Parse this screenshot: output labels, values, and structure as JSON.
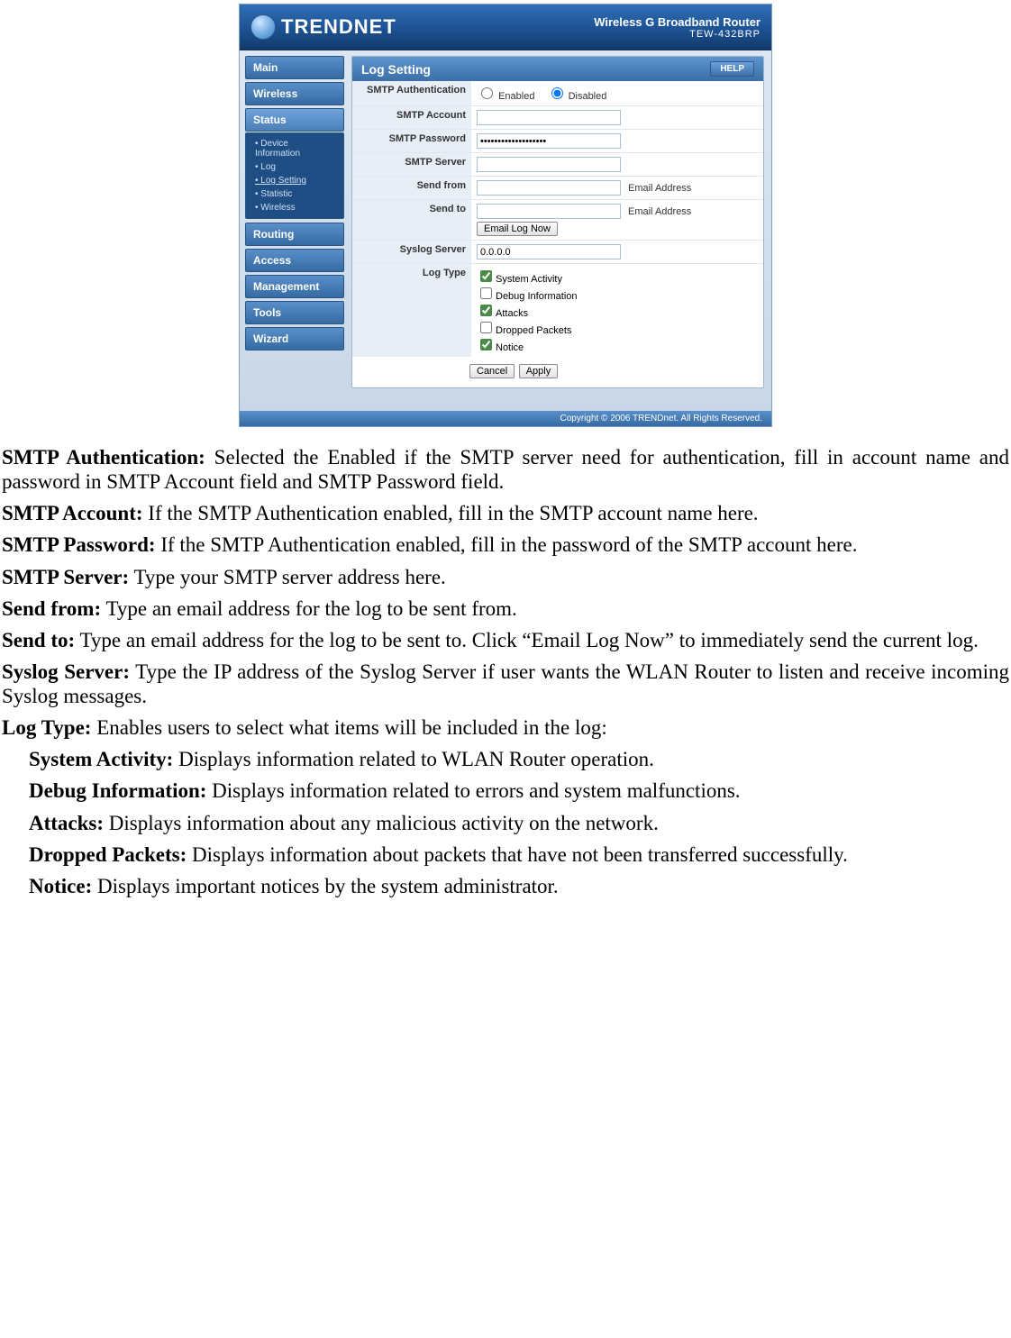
{
  "brand": "TRENDNET",
  "device_name": "Wireless G Broadband Router",
  "device_model": "TEW-432BRP",
  "nav": {
    "main": "Main",
    "wireless": "Wireless",
    "status": "Status",
    "routing": "Routing",
    "access": "Access",
    "management": "Management",
    "tools": "Tools",
    "wizard": "Wizard"
  },
  "subnav": {
    "device_info": "Device Information",
    "log": "Log",
    "log_setting": "Log Setting",
    "statistic": "Statistic",
    "wireless": "Wireless"
  },
  "panel": {
    "title": "Log Setting",
    "help": "HELP",
    "labels": {
      "smtp_auth": "SMTP Authentication",
      "smtp_account": "SMTP Account",
      "smtp_password": "SMTP Password",
      "smtp_server": "SMTP Server",
      "send_from": "Send from",
      "send_to": "Send to",
      "syslog_server": "Syslog Server",
      "log_type": "Log Type"
    },
    "radio_enabled": "Enabled",
    "radio_disabled": "Disabled",
    "values": {
      "smtp_account": "",
      "smtp_password": "•••••••••••••••••••",
      "smtp_server": "",
      "send_from": "",
      "send_to": "",
      "syslog_server": "0.0.0.0"
    },
    "hints": {
      "from": "Email Address",
      "to": "Email Address"
    },
    "buttons": {
      "email_now": "Email Log Now",
      "cancel": "Cancel",
      "apply": "Apply"
    },
    "log_types": {
      "system": "System Activity",
      "debug": "Debug Information",
      "attacks": "Attacks",
      "dropped": "Dropped Packets",
      "notice": "Notice"
    }
  },
  "footer": "Copyright © 2006 TRENDnet. All Rights Reserved.",
  "desc": {
    "p1_b": "SMTP Authentication:",
    "p1": " Selected the Enabled if the SMTP server need for authentication, fill in account name and password in SMTP Account field and SMTP Password field.",
    "p2_b": "SMTP Account:",
    "p2": " If the SMTP Authentication enabled, fill in the SMTP account name here.",
    "p3_b": "SMTP Password:",
    "p3": " If the SMTP Authentication enabled, fill in the password of the SMTP account here.",
    "p4_b": "SMTP Server:",
    "p4": " Type your SMTP server address here.",
    "p5_b": "Send from:",
    "p5": " Type an email address for the log to be sent from.",
    "p6_b": "Send to:",
    "p6": " Type an email address for the log to be sent to. Click “Email Log Now” to immediately send the current log.",
    "p7_b": "Syslog Server:",
    "p7": " Type the IP address of the Syslog Server if user wants the WLAN Router to listen and receive incoming Syslog messages.",
    "p8_b": "Log Type:",
    "p8": " Enables users to select what items will be included in the log:",
    "s1_b": "System Activity:",
    "s1": " Displays information related to WLAN Router operation.",
    "s2_b": "Debug Information:",
    "s2": " Displays information related to errors and system malfunctions.",
    "s3_b": "Attacks:",
    "s3": " Displays information about any malicious activity on the network.",
    "s4_b": "Dropped Packets:",
    "s4": " Displays information about packets that have not been transferred successfully.",
    "s5_b": "Notice:",
    "s5": " Displays important notices by the system administrator."
  }
}
